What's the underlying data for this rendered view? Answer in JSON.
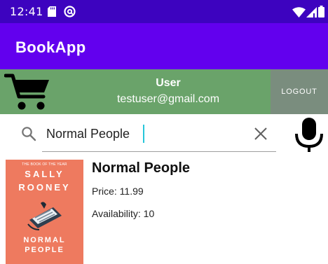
{
  "status_bar": {
    "time": "12:41",
    "icons": [
      "sd-card-icon",
      "at-sign-icon",
      "wifi-icon",
      "signal-icon",
      "battery-icon"
    ]
  },
  "app_bar": {
    "title": "BookApp",
    "color": "#6200ee"
  },
  "user_bar": {
    "icon": "shopping-cart-icon",
    "name": "User",
    "email": "testuser@gmail.com",
    "logout_label": "LOGOUT",
    "color": "#6aa36a"
  },
  "search": {
    "value": "Normal People",
    "icons": [
      "search-icon",
      "clear-icon",
      "microphone-icon"
    ]
  },
  "results": [
    {
      "title": "Normal People",
      "price": "Price: 11.99",
      "availability": "Availability: 10",
      "cover": {
        "tagline": "THE BOOK OF THE YEAR",
        "author": [
          "SALLY",
          "ROONEY"
        ],
        "title": [
          "NORMAL",
          "PEOPLE"
        ],
        "color": "#ee7a5f"
      }
    }
  ]
}
